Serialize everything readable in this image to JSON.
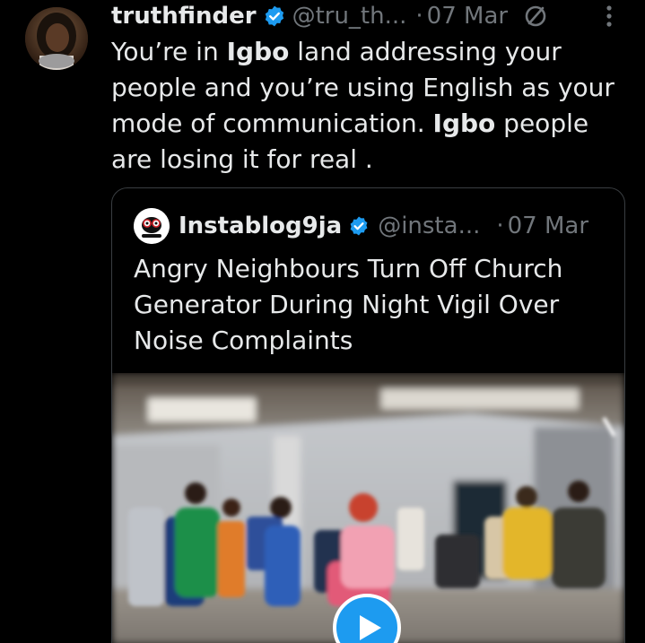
{
  "tweet": {
    "display_name": "truthfinder",
    "handle": "@tru_th...",
    "separator": "·",
    "date": "07 Mar",
    "text_parts": {
      "p1": "You’re in ",
      "b1": "Igbo",
      "p2": " land addressing your people and you’re using English as your mode of communication. ",
      "b2": "Igbo",
      "p3": " people are losing it for real ."
    },
    "icons": {
      "verified": "verified-badge-icon",
      "muted": "no-symbol-icon",
      "more": "more-vertical-icon"
    }
  },
  "quote": {
    "display_name": "Instablog9ja",
    "handle": "@insta...",
    "separator": "·",
    "date": "07 Mar",
    "text": "Angry Neighbours Turn Off Church Generator During Night Vigil Over Noise Complaints",
    "media": {
      "type": "video",
      "play_icon": "play-icon"
    }
  },
  "colors": {
    "background": "#000000",
    "text": "#e7e9ea",
    "secondary": "#71767b",
    "verified": "#1d9bf0",
    "border": "#3a3e42"
  }
}
